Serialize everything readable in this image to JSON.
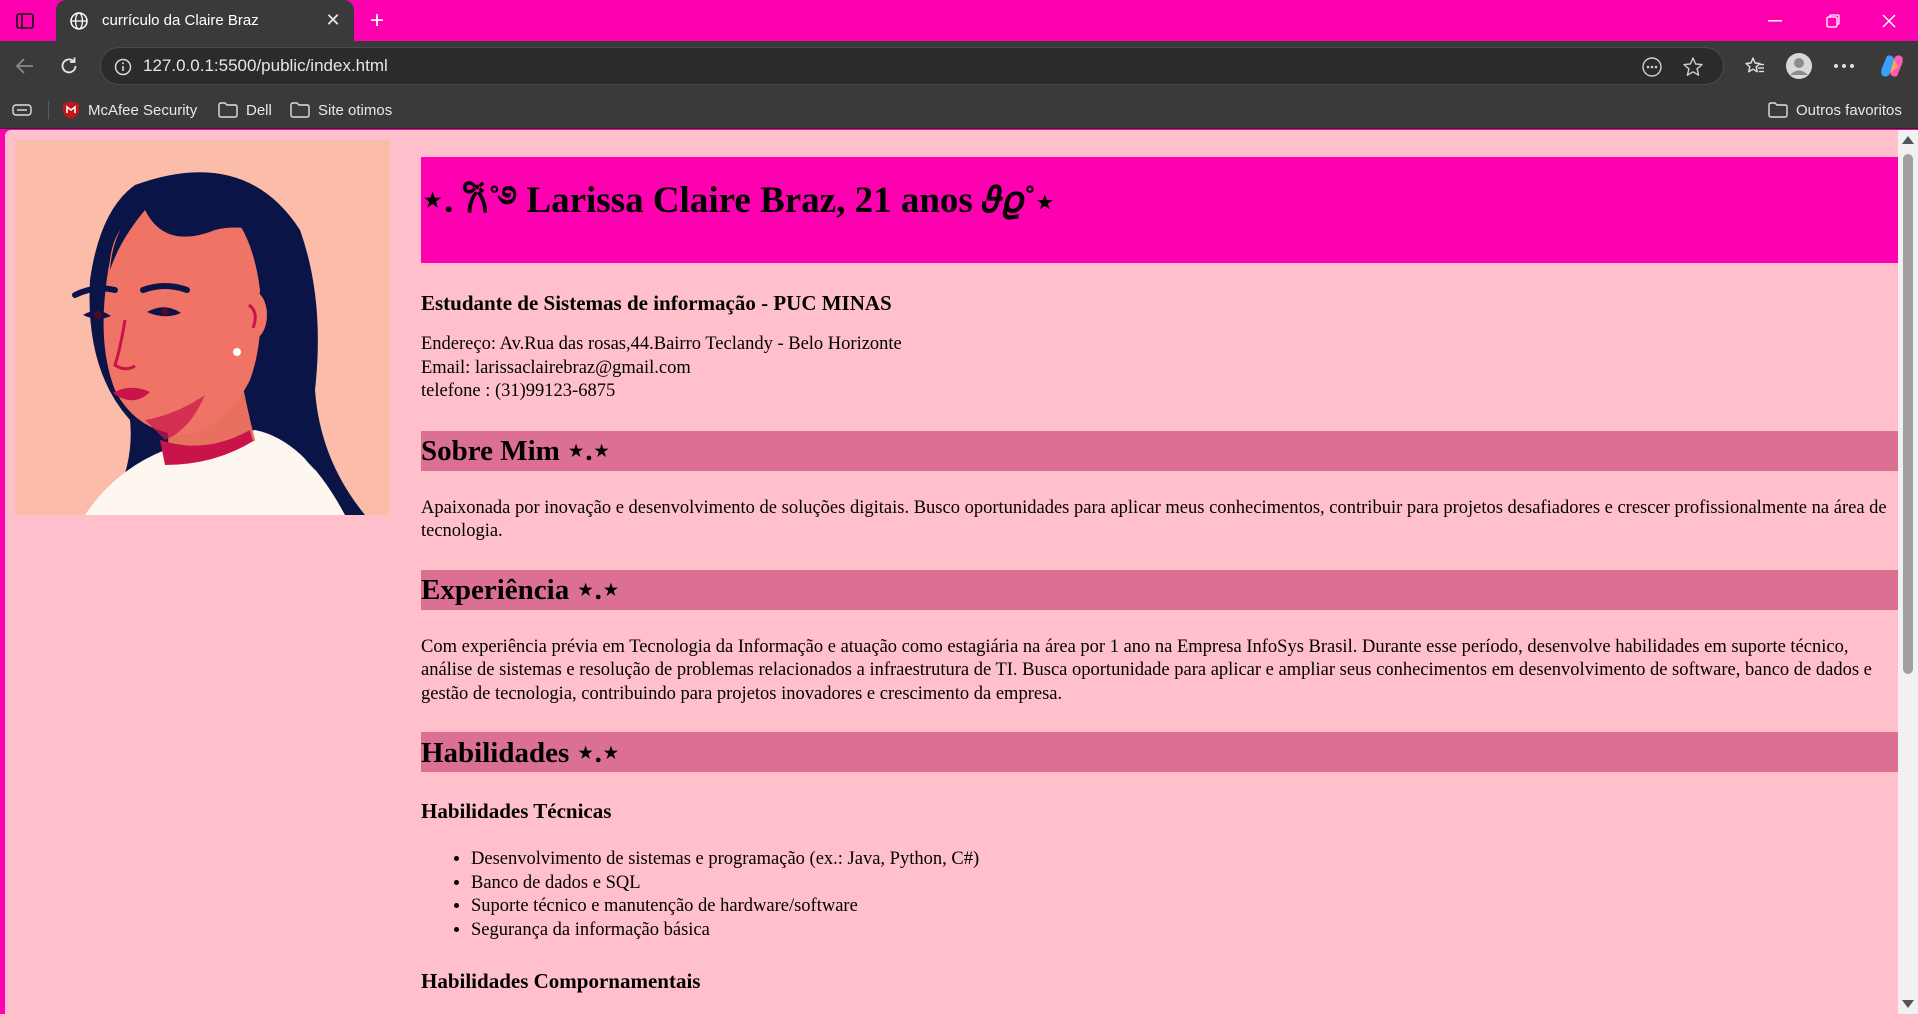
{
  "browser": {
    "tab_title": "currículo da Claire Braz",
    "url": "127.0.0.1:5500/public/index.html",
    "bookmarks": [
      {
        "label": "McAfee Security"
      },
      {
        "label": "Dell"
      },
      {
        "label": "Site otimos"
      }
    ],
    "other_favorites": "Outros favoritos",
    "theme_color": "#ff00b0"
  },
  "page": {
    "name": "⋆. 𐙚˚࿔ Larissa Claire Braz, 21 anos 𝜗𝜚˚⋆",
    "subtitle": "Estudante de Sistemas de informação - PUC MINAS",
    "address": "Endereço: Av.Rua das rosas,44.Bairro Teclandy - Belo Horizonte",
    "email": "Email: larissaclairebraz@gmail.com",
    "phone": "telefone : (31)99123-6875",
    "sections": {
      "about_title": "Sobre Mim ⋆.⋆",
      "about_text": "Apaixonada por inovação e desenvolvimento de soluções digitais. Busco oportunidades para aplicar meus conhecimentos, contribuir para projetos desafiadores e crescer profissionalmente na área de tecnologia.",
      "experience_title": "Experiência ⋆.⋆",
      "experience_text": "Com experiência prévia em Tecnologia da Informação e atuação como estagiária na área por 1 ano na Empresa InfoSys Brasil. Durante esse período, desenvolve habilidades em suporte técnico, análise de sistemas e resolução de problemas relacionados a infraestrutura de TI. Busca oportunidade para aplicar e ampliar seus conhecimentos em desenvolvimento de software, banco de dados e gestão de tecnologia, contribuindo para projetos inovadores e crescimento da empresa.",
      "skills_title": "Habilidades ⋆.⋆",
      "technical_title": "Habilidades Técnicas",
      "technical_items": [
        "Desenvolvimento de sistemas e programação (ex.: Java, Python, C#)",
        "Banco de dados e SQL",
        "Suporte técnico e manutenção de hardware/software",
        "Segurança da informação básica"
      ],
      "behavioral_title": "Habilidades Compornamentais"
    },
    "colors": {
      "page_bg": "#ffc0cb",
      "header_bg": "#ff00b0",
      "section_bg": "#db7093"
    }
  }
}
